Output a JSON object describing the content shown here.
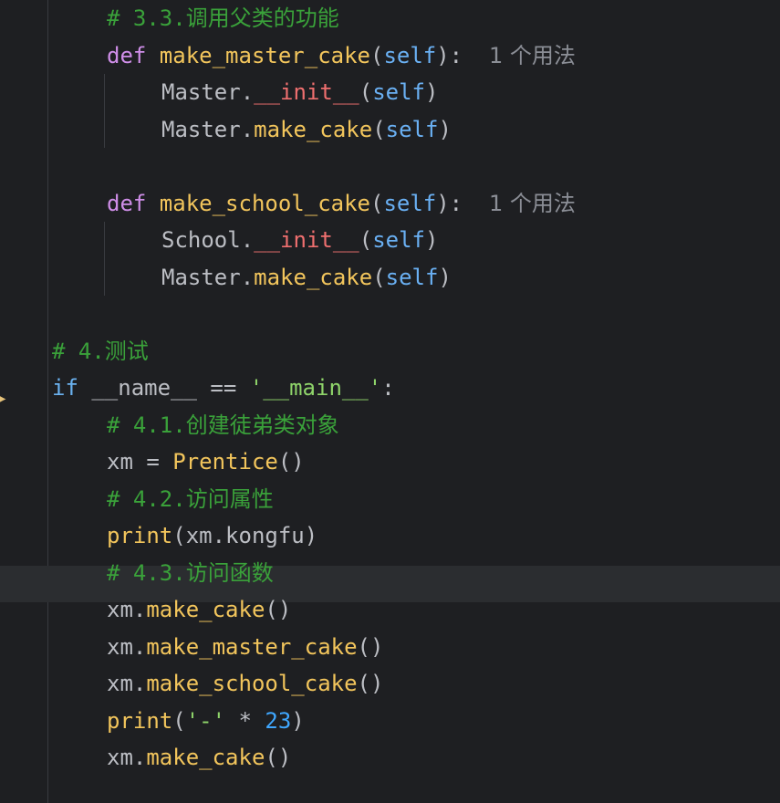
{
  "editor": {
    "run_marker_icon": "run-arrow-icon",
    "lines": [
      {
        "indent": 1,
        "tokens": [
          {
            "t": "# 3.3.调用父类的功能",
            "k": "comment"
          }
        ]
      },
      {
        "indent": 1,
        "tokens": [
          {
            "t": "def ",
            "k": "kw"
          },
          {
            "t": "make_master_cake",
            "k": "fn"
          },
          {
            "t": "(",
            "k": "plain"
          },
          {
            "t": "self",
            "k": "self"
          },
          {
            "t": "):  ",
            "k": "plain"
          },
          {
            "t": "1 个用法",
            "k": "hint"
          }
        ]
      },
      {
        "indent": 2,
        "guide": true,
        "tokens": [
          {
            "t": "Master.",
            "k": "plain"
          },
          {
            "t": "__init__",
            "k": "dunder"
          },
          {
            "t": "(",
            "k": "plain"
          },
          {
            "t": "self",
            "k": "self"
          },
          {
            "t": ")",
            "k": "plain"
          }
        ]
      },
      {
        "indent": 2,
        "guide": true,
        "tokens": [
          {
            "t": "Master.",
            "k": "plain"
          },
          {
            "t": "make_cake",
            "k": "method"
          },
          {
            "t": "(",
            "k": "plain"
          },
          {
            "t": "self",
            "k": "self"
          },
          {
            "t": ")",
            "k": "plain"
          }
        ]
      },
      {
        "indent": 0,
        "tokens": []
      },
      {
        "indent": 1,
        "tokens": [
          {
            "t": "def ",
            "k": "kw"
          },
          {
            "t": "make_school_cake",
            "k": "fn"
          },
          {
            "t": "(",
            "k": "plain"
          },
          {
            "t": "self",
            "k": "self"
          },
          {
            "t": "):  ",
            "k": "plain"
          },
          {
            "t": "1 个用法",
            "k": "hint"
          }
        ]
      },
      {
        "indent": 2,
        "guide": true,
        "tokens": [
          {
            "t": "School.",
            "k": "plain"
          },
          {
            "t": "__init__",
            "k": "dunder"
          },
          {
            "t": "(",
            "k": "plain"
          },
          {
            "t": "self",
            "k": "self"
          },
          {
            "t": ")",
            "k": "plain"
          }
        ]
      },
      {
        "indent": 2,
        "guide": true,
        "tokens": [
          {
            "t": "Master.",
            "k": "plain"
          },
          {
            "t": "make_cake",
            "k": "method"
          },
          {
            "t": "(",
            "k": "plain"
          },
          {
            "t": "self",
            "k": "self"
          },
          {
            "t": ")",
            "k": "plain"
          }
        ]
      },
      {
        "indent": 0,
        "tokens": []
      },
      {
        "indent": 0,
        "tokens": [
          {
            "t": "# 4.测试",
            "k": "comment"
          }
        ]
      },
      {
        "indent": 0,
        "tokens": [
          {
            "t": "if ",
            "k": "kwblue"
          },
          {
            "t": "__name__ == ",
            "k": "plain"
          },
          {
            "t": "'__main__'",
            "k": "str"
          },
          {
            "t": ":",
            "k": "plain"
          }
        ]
      },
      {
        "indent": 1,
        "tokens": [
          {
            "t": "# 4.1.创建徒弟类对象",
            "k": "comment"
          }
        ]
      },
      {
        "indent": 1,
        "tokens": [
          {
            "t": "xm = ",
            "k": "plain"
          },
          {
            "t": "Prentice",
            "k": "fn"
          },
          {
            "t": "()",
            "k": "plain"
          }
        ]
      },
      {
        "indent": 1,
        "tokens": [
          {
            "t": "# 4.2.访问属性",
            "k": "comment"
          }
        ]
      },
      {
        "indent": 1,
        "tokens": [
          {
            "t": "print",
            "k": "print"
          },
          {
            "t": "(xm.kongfu)",
            "k": "plain"
          }
        ]
      },
      {
        "indent": 1,
        "tokens": [
          {
            "t": "# 4.3.访问函数",
            "k": "comment"
          }
        ]
      },
      {
        "indent": 1,
        "tokens": [
          {
            "t": "xm.",
            "k": "plain"
          },
          {
            "t": "make_cake",
            "k": "method"
          },
          {
            "t": "()",
            "k": "plain"
          }
        ]
      },
      {
        "indent": 1,
        "tokens": [
          {
            "t": "xm.",
            "k": "plain"
          },
          {
            "t": "make_master_cake",
            "k": "method"
          },
          {
            "t": "()",
            "k": "plain"
          }
        ]
      },
      {
        "indent": 1,
        "tokens": [
          {
            "t": "xm.",
            "k": "plain"
          },
          {
            "t": "make_school_cake",
            "k": "method"
          },
          {
            "t": "()",
            "k": "plain"
          }
        ]
      },
      {
        "indent": 1,
        "tokens": [
          {
            "t": "print",
            "k": "print"
          },
          {
            "t": "(",
            "k": "plain"
          },
          {
            "t": "'-'",
            "k": "str"
          },
          {
            "t": " * ",
            "k": "plain"
          },
          {
            "t": "23",
            "k": "num"
          },
          {
            "t": ")",
            "k": "plain"
          }
        ]
      },
      {
        "indent": 1,
        "tokens": [
          {
            "t": "xm.",
            "k": "plain"
          },
          {
            "t": "make_cake",
            "k": "method"
          },
          {
            "t": "()",
            "k": "plain"
          }
        ]
      }
    ],
    "current_line_index": 15
  }
}
